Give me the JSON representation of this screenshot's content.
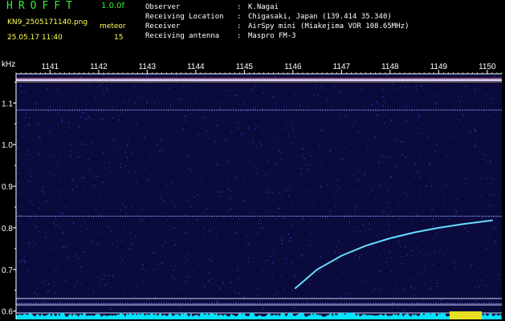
{
  "header": {
    "app_title": "HROFFT",
    "version": "1.0.0f",
    "file_name": "KN9_2505171140.png",
    "timestamp": "25.05.17 11:40",
    "meteor_label": "meteor",
    "meteor_count": "15"
  },
  "info": [
    {
      "key": "Observer",
      "sep": ":",
      "value": "K.Nagai"
    },
    {
      "key": "Receiving Location",
      "sep": ":",
      "value": "Chigasaki, Japan (139.414 35.340)"
    },
    {
      "key": "Receiver",
      "sep": ":",
      "value": "AirSpy mini (Miakejima VOR 108.65MHz)"
    },
    {
      "key": "Receiving antenna",
      "sep": ":",
      "value": "Maspro FM-3"
    }
  ],
  "colors": {
    "background": "#000000",
    "spectrogram_bg": "#0a0a3c",
    "header_green": "#33ee33",
    "header_yellow": "#ffff55",
    "text": "#ffffff",
    "echo": "#66ddff",
    "noise_floor": "#00e5ff"
  },
  "chart_data": {
    "type": "heatmap",
    "title": "",
    "x_unit": "",
    "y_unit": "kHz",
    "x_ticks": [
      "1141",
      "1142",
      "1143",
      "1144",
      "1145",
      "1146",
      "1147",
      "1148",
      "1149",
      "1150"
    ],
    "y_ticks": [
      "1.1",
      "1.0",
      "0.9",
      "0.8",
      "0.7",
      "0.6"
    ],
    "y_range": [
      0.58,
      1.17
    ],
    "x_range": [
      1140.3,
      1150.3
    ],
    "horizontal_lines_khz": [
      1.083,
      0.828,
      0.618
    ],
    "strong_carrier_khz": 1.155,
    "meteor_echo": {
      "x": [
        1146.05,
        1146.5,
        1147.0,
        1147.5,
        1148.0,
        1148.5,
        1149.0,
        1149.5,
        1150.1
      ],
      "y_khz": [
        0.655,
        0.7,
        0.733,
        0.757,
        0.775,
        0.789,
        0.8,
        0.809,
        0.818
      ]
    }
  }
}
